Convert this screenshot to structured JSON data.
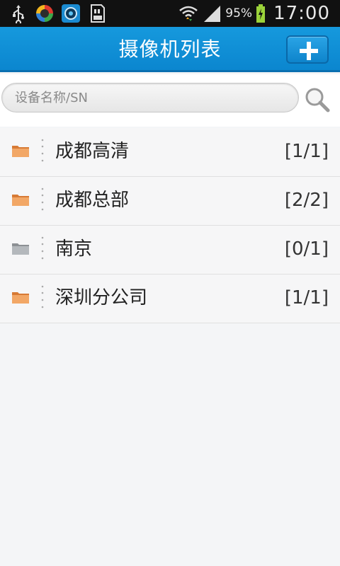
{
  "status_bar": {
    "icons": [
      "usb-icon",
      "app-icon-1",
      "app-icon-2",
      "sd-card-icon",
      "wifi-icon",
      "signal-icon",
      "battery-charging-icon"
    ],
    "battery_percent": "95%",
    "time": "17:00"
  },
  "header": {
    "title": "摄像机列表",
    "add_button_icon": "plus-icon"
  },
  "search": {
    "placeholder": "设备名称/SN",
    "value": "",
    "icon": "search-icon"
  },
  "list": {
    "items": [
      {
        "name": "成都高清",
        "count": "[1/1]",
        "folder_state": "active"
      },
      {
        "name": "成都总部",
        "count": "[2/2]",
        "folder_state": "active"
      },
      {
        "name": "南京",
        "count": "[0/1]",
        "folder_state": "inactive"
      },
      {
        "name": "深圳分公司",
        "count": "[1/1]",
        "folder_state": "active"
      }
    ]
  },
  "colors": {
    "header_blue": "#0b86cf",
    "folder_orange": "#e8924a",
    "folder_gray": "#a8acb0",
    "status_bar_bg": "#111111"
  }
}
